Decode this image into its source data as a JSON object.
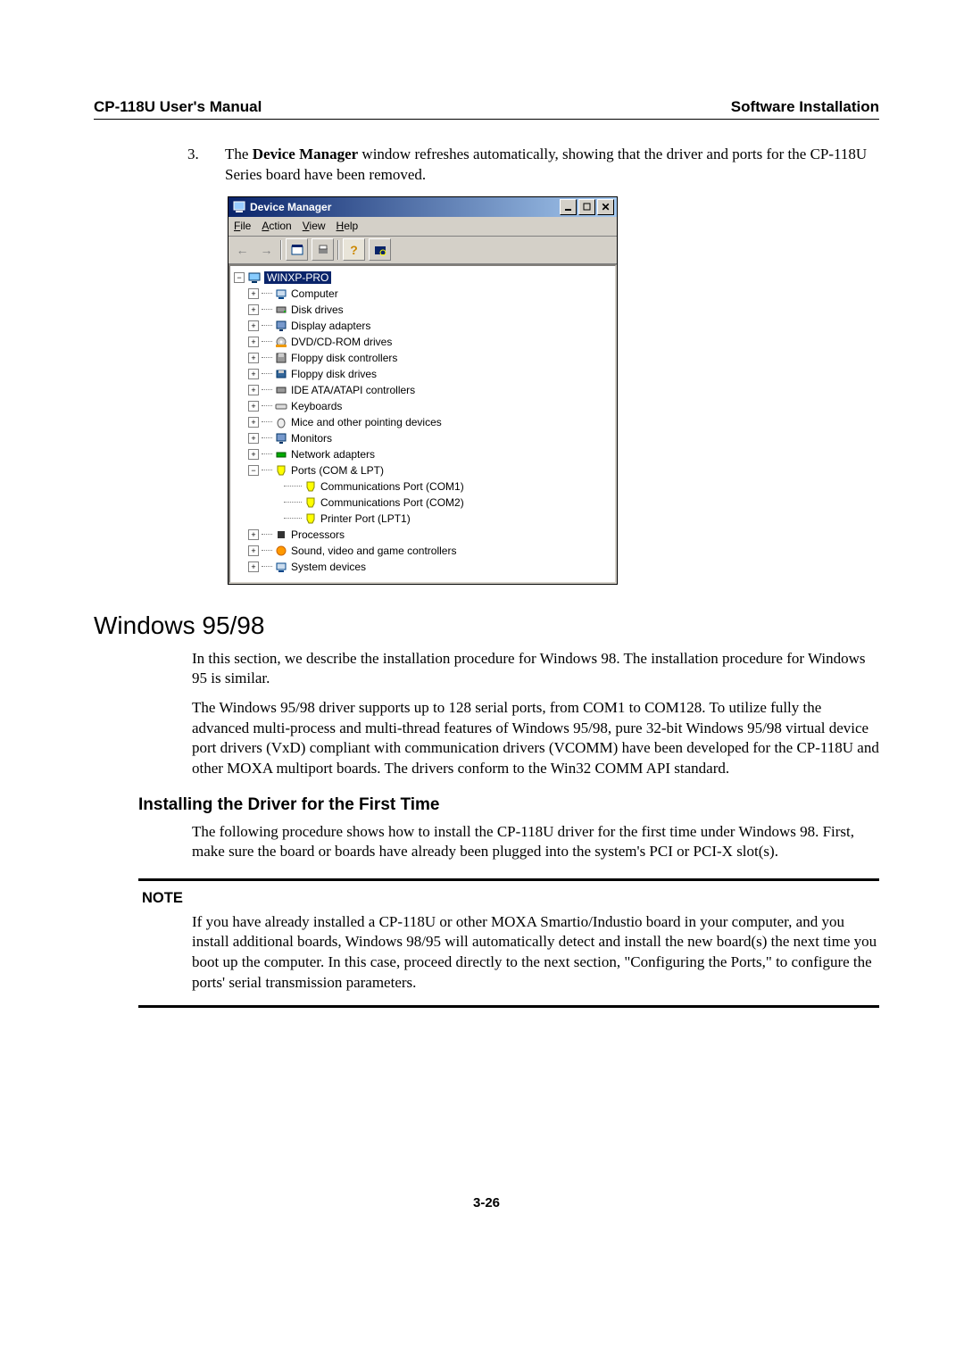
{
  "header": {
    "left": "CP-118U User's Manual",
    "right": "Software Installation"
  },
  "step": {
    "num": "3.",
    "text_prefix": "The ",
    "text_bold": "Device Manager",
    "text_suffix": " window refreshes automatically, showing that the driver and ports for the CP-118U Series board have been removed."
  },
  "dm": {
    "title": "Device Manager",
    "menu": {
      "file": "File",
      "action": "Action",
      "view": "View",
      "help": "Help"
    },
    "root": "WINXP-PRO",
    "items": [
      "Computer",
      "Disk drives",
      "Display adapters",
      "DVD/CD-ROM drives",
      "Floppy disk controllers",
      "Floppy disk drives",
      "IDE ATA/ATAPI controllers",
      "Keyboards",
      "Mice and other pointing devices",
      "Monitors",
      "Network adapters",
      "Ports (COM & LPT)"
    ],
    "ports": [
      "Communications Port (COM1)",
      "Communications Port (COM2)",
      "Printer Port (LPT1)"
    ],
    "tail": [
      "Processors",
      "Sound, video and game controllers",
      "System devices"
    ]
  },
  "sect_win": "Windows 95/98",
  "p1": "In this section, we describe the installation procedure for Windows 98. The installation procedure for Windows 95 is similar.",
  "p2": "The Windows 95/98 driver supports up to 128 serial ports, from COM1 to COM128. To utilize fully the advanced multi-process and multi-thread features of Windows 95/98, pure 32-bit Windows 95/98 virtual device port drivers (VxD) compliant with communication drivers (VCOMM) have been developed for the CP-118U and other MOXA multiport boards. The drivers conform to the Win32 COMM API standard.",
  "sub_install": "Installing the Driver for the First Time",
  "p3": "The following procedure shows how to install the CP-118U driver for the first time under Windows 98. First, make sure the board or boards have already been plugged into the system's PCI or PCI-X slot(s).",
  "note_label": "NOTE",
  "note_text": "If you have already installed a CP-118U or other MOXA Smartio/Industio board in your computer, and you install additional boards, Windows 98/95 will automatically detect and install the new board(s) the next time you boot up the computer. In this case, proceed directly to the next section, \"Configuring the Ports,\" to configure the ports' serial transmission parameters.",
  "pagenum": "3-26"
}
